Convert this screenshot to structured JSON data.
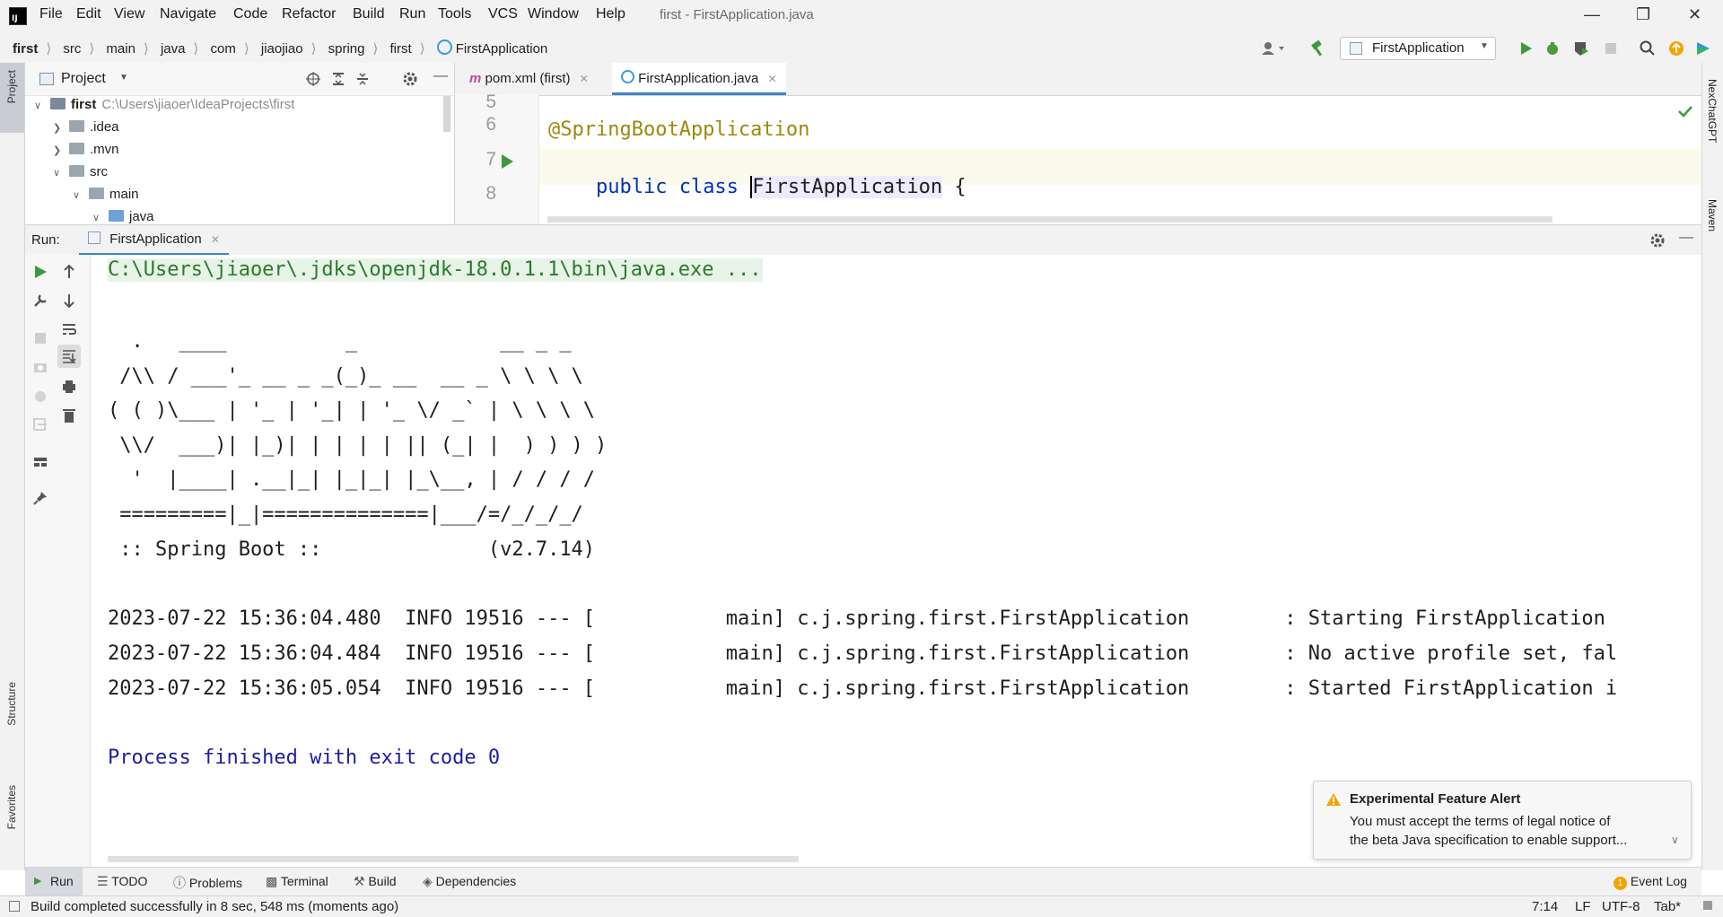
{
  "window": {
    "title": "first - FirstApplication.java"
  },
  "menu": {
    "items": [
      "File",
      "Edit",
      "View",
      "Navigate",
      "Code",
      "Refactor",
      "Build",
      "Run",
      "Tools",
      "VCS",
      "Window",
      "Help"
    ]
  },
  "breadcrumb": {
    "items": [
      "first",
      "src",
      "main",
      "java",
      "com",
      "jiaojiao",
      "spring",
      "first",
      "FirstApplication"
    ]
  },
  "toolbar": {
    "run_config": "FirstApplication"
  },
  "left_strip": {
    "project_tab": "Project",
    "structure_tab": "Structure",
    "favorites_tab": "Favorites"
  },
  "right_strip": {
    "nexchatgpt_tab": "NexChatGPT",
    "maven_tab": "Maven"
  },
  "project_panel": {
    "title": "Project",
    "root_name": "first",
    "root_path": "C:\\Users\\jiaoer\\IdeaProjects\\first",
    "nodes": [
      ".idea",
      ".mvn",
      "src",
      "main",
      "java"
    ]
  },
  "editor": {
    "tabs": [
      "pom.xml (first)",
      "FirstApplication.java"
    ],
    "active_tab": "FirstApplication.java",
    "line_numbers": [
      "5",
      "6",
      "7",
      "8"
    ],
    "annotation": "@SpringBootApplication",
    "code_keywords": "public class",
    "class_name": "FirstApplication",
    "brace": "{"
  },
  "run_panel": {
    "label": "Run:",
    "tab": "FirstApplication",
    "command": "C:\\Users\\jiaoer\\.jdks\\openjdk-18.0.1.1\\bin\\java.exe ...",
    "banner": [
      "  .   ____          _            __ _ _",
      " /\\\\ / ___'_ __ _ _(_)_ __  __ _ \\ \\ \\ \\",
      "( ( )\\___ | '_ | '_| | '_ \\/ _` | \\ \\ \\ \\",
      " \\\\/  ___)| |_)| | | | | || (_| |  ) ) ) )",
      "  '  |____| .__|_| |_|_| |_\\__, | / / / /",
      " =========|_|==============|___/=/_/_/_/",
      " :: Spring Boot ::              (v2.7.14)"
    ],
    "logs": [
      "2023-07-22 15:36:04.480  INFO 19516 --- [           main] c.j.spring.first.FirstApplication        : Starting FirstApplication",
      "2023-07-22 15:36:04.484  INFO 19516 --- [           main] c.j.spring.first.FirstApplication        : No active profile set, fal",
      "2023-07-22 15:36:05.054  INFO 19516 --- [           main] c.j.spring.first.FirstApplication        : Started FirstApplication i"
    ],
    "exit_message": "Process finished with exit code 0"
  },
  "notification": {
    "title": "Experimental Feature Alert",
    "line1": "You must accept the terms of legal notice of",
    "line2": "the beta Java specification to enable support..."
  },
  "bottom_tabs": [
    "Run",
    "TODO",
    "Problems",
    "Terminal",
    "Build",
    "Dependencies"
  ],
  "event_log": {
    "label": "Event Log",
    "count": "1"
  },
  "status_bar": {
    "message": "Build completed successfully in 8 sec, 548 ms (moments ago)",
    "position": "7:14",
    "line_ending": "LF",
    "encoding": "UTF-8",
    "indent": "Tab*"
  },
  "colors": {
    "accent": "#4083c9",
    "run_green": "#3c9a3c",
    "annotation": "#9e880d",
    "keyword": "#0033b3",
    "exit_blue": "#1e1e9e"
  }
}
